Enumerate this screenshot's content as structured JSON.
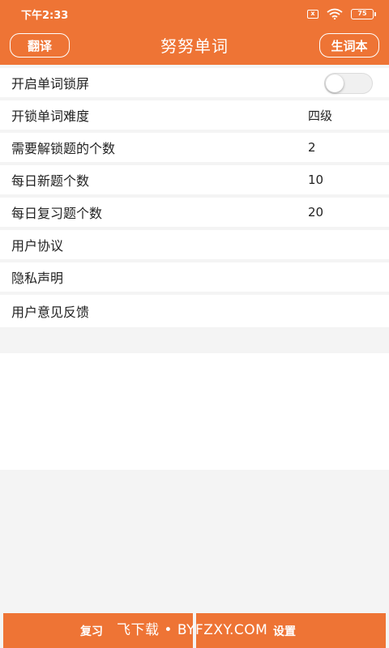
{
  "status_bar": {
    "time": "下午2:33",
    "sim_label": "x",
    "battery": "75"
  },
  "header": {
    "translate_button": "翻译",
    "title": "努努单词",
    "vocab_button": "生词本"
  },
  "settings": {
    "rows": [
      {
        "label": "开启单词锁屏",
        "toggle_on": false
      },
      {
        "label": "开锁单词难度",
        "value": "四级"
      },
      {
        "label": "需要解锁题的个数",
        "value": "2"
      },
      {
        "label": "每日新题个数",
        "value": "10"
      },
      {
        "label": "每日复习题个数",
        "value": "20"
      },
      {
        "label": "用户协议"
      },
      {
        "label": "隐私声明"
      },
      {
        "label": "用户意见反馈"
      }
    ]
  },
  "tabs": {
    "review": "复习",
    "settings": "设置"
  },
  "watermark": "飞下载 • BYFZXY.COM",
  "colors": {
    "accent": "#ee7435",
    "background": "#f4f4f4"
  }
}
